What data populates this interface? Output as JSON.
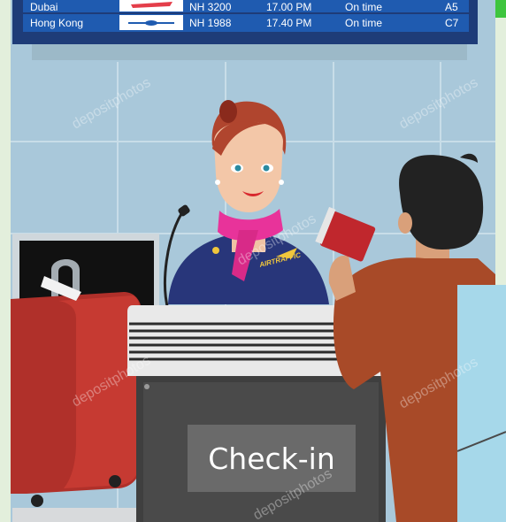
{
  "departures_board": {
    "rows": [
      {
        "city": "Dubai",
        "flight": "NH  3200",
        "time": "17.00 PM",
        "status": "On time",
        "gate": "A5"
      },
      {
        "city": "Hong Kong",
        "flight": "NH  1988",
        "time": "17.40 PM",
        "status": "On time",
        "gate": "C7"
      }
    ]
  },
  "counter": {
    "sign": "Check-in"
  },
  "uniform": {
    "airline_logo": "AIRTRAFFIC"
  },
  "watermark": {
    "text": "depositphotos"
  },
  "colors": {
    "wall": "#a9c8da",
    "board": "#1e3c78",
    "uniform": "#28367a",
    "suitcase": "#b0302a",
    "counter": "#3f3f3f",
    "scarf": "#e8339a"
  }
}
